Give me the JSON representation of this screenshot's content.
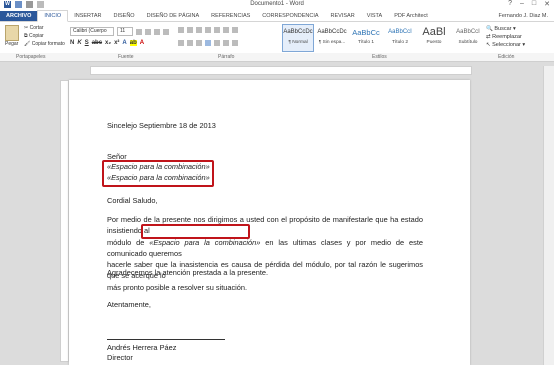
{
  "window": {
    "title": "Documento1 - Word",
    "user": "Fernando J. Diaz M."
  },
  "tabs": [
    "ARCHIVO",
    "INICIO",
    "INSERTAR",
    "DISEÑO",
    "DISEÑO DE PÁGINA",
    "REFERENCIAS",
    "CORRESPONDENCIA",
    "REVISAR",
    "VISTA",
    "PDF Architect"
  ],
  "ribbon": {
    "paste": "Pegar",
    "cut": "Cortar",
    "copy": "Copiar",
    "format_painter": "Copiar formato",
    "font_name": "Calibri (Cuerpo",
    "font_size": "11",
    "styles": [
      {
        "preview": "AaBbCcDc",
        "name": "¶ Normal"
      },
      {
        "preview": "AaBbCcDc",
        "name": "¶ Sin espa..."
      },
      {
        "preview": "AaBbCc",
        "name": "Título 1"
      },
      {
        "preview": "AaBbCcI",
        "name": "Título 2"
      },
      {
        "preview": "AaBl",
        "name": "Puesto"
      },
      {
        "preview": "AaBbCcI",
        "name": "Subtítulo"
      }
    ],
    "find": "Buscar",
    "replace": "Reemplazar",
    "select": "Seleccionar",
    "groups": [
      "Portapapeles",
      "Fuente",
      "Párrafo",
      "Estilos",
      "Edición"
    ]
  },
  "document": {
    "date": "Sincelejo Septiembre 18 de 2013",
    "salutation_title": "Señor",
    "field1": "«Espacio para la combinación»",
    "field2": "«Espacio para la combinación»",
    "greeting": "Cordial Saludo,",
    "body1_a": "Por medio de la presente nos dirigimos a usted con el propósito de manifestarle que ha estado insistiendo al",
    "body1_b_pre": "módulo de ",
    "body1_field": "«Espacio para la combinación»",
    "body1_b_post": " en las ultimas clases y por medio de este comunicado queremos",
    "body1_c": "hacerle saber que la inasistencia es causa de pérdida del módulo, por tal razón le sugerimos que se acerque lo",
    "body1_d": "más pronto posible a resolver su situación.",
    "thanks": "Agradecemos la atención prestada a la presente.",
    "closing": "Atentamente,",
    "signer": "Andrés Herrera Páez",
    "role": "Director"
  }
}
